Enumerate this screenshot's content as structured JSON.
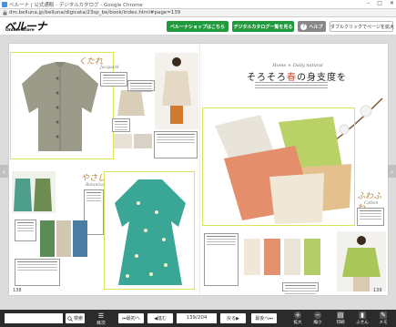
{
  "window": {
    "title": "ベルーナ | 公式通販 - デジタルカタログ - Google Chrome",
    "url": "dm.belluna.jp/belluna/digicata/23sp_be/book/index.html#page=139"
  },
  "brand": {
    "name": "ベルーナ",
    "sub": "Online Store"
  },
  "header_buttons": {
    "shop": "ベルーナショップはこちら",
    "catalog": "デジタルカタログ一覧を見る",
    "help": "ヘルプ",
    "double": "ダブルクリックでページを拡大"
  },
  "left_page": {
    "script1": "くたれ",
    "label1": "Jacquard",
    "script2": "やさし",
    "label2": "Botanical",
    "page_number": "138"
  },
  "right_page": {
    "headline_en": "Home × Daily natural",
    "headline_pre": "そろそろ",
    "headline_accent": "春",
    "headline_post": "の身支度を",
    "script": "ふわふわ",
    "label": "Cotton",
    "page_number": "139"
  },
  "toolbar": {
    "search_placeholder": "",
    "search": "検索",
    "index": "目次",
    "first": "最初へ",
    "next": "進む",
    "page": "139/204",
    "prev": "戻る",
    "last": "最後へ",
    "zoom_in": "拡大",
    "zoom_out": "縮小",
    "print": "印刷",
    "bookmark": "ふせん",
    "memo": "メモ"
  },
  "colors": {
    "header_green": "#1f9a3c",
    "selection": "#d9e45a",
    "toolbar_bg": "#2b2b2b",
    "accent_red": "#d34a2c"
  }
}
